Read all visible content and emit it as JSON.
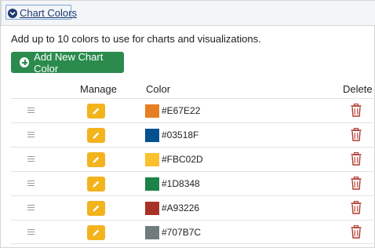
{
  "header": {
    "title": "Chart Colors",
    "icon": "chevron-down-icon"
  },
  "description": "Add up to 10 colors to use for charts and visualizations.",
  "add_button": {
    "label": "Add New Chart Color",
    "icon": "plus-circle-icon",
    "color": "#2a8b4d"
  },
  "columns": {
    "manage": "Manage",
    "color": "Color",
    "delete": "Delete"
  },
  "rows": [
    {
      "hex": "#E67E22"
    },
    {
      "hex": "#03518F"
    },
    {
      "hex": "#FBC02D"
    },
    {
      "hex": "#1D8348"
    },
    {
      "hex": "#A93226"
    },
    {
      "hex": "#707B7C"
    }
  ],
  "row_icons": {
    "drag": "drag-handle-icon",
    "edit": "pencil-icon",
    "delete": "trash-icon"
  },
  "accents": {
    "edit": "#f2b31d",
    "delete": "#b03a2e",
    "link": "#1e3a6e"
  }
}
